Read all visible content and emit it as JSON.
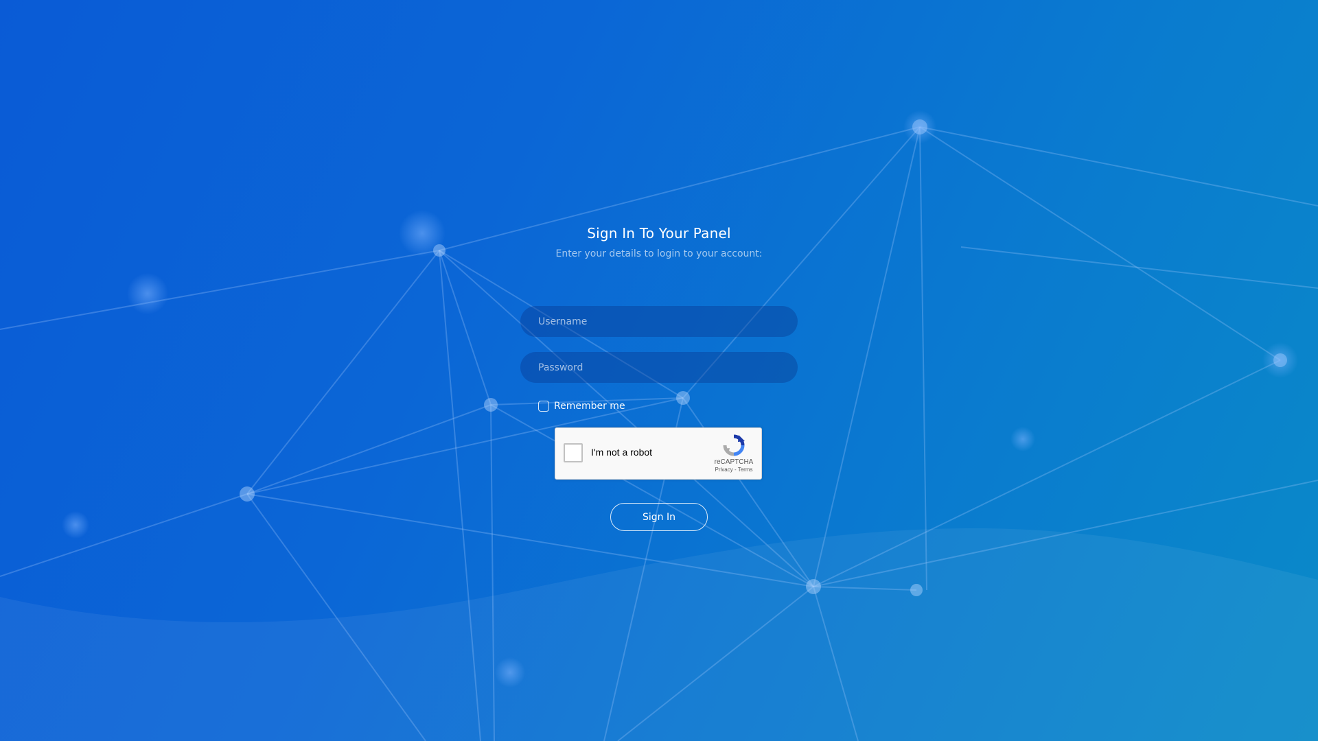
{
  "login": {
    "title": "Sign In To Your Panel",
    "subtitle": "Enter your details to login to your account:",
    "username_placeholder": "Username",
    "password_placeholder": "Password",
    "remember_label": "Remember me",
    "submit_label": "Sign In"
  },
  "captcha": {
    "label": "I'm not a robot",
    "brand": "reCAPTCHA",
    "legal": "Privacy - Terms"
  },
  "colors": {
    "background_start": "#0a5bd6",
    "background_end": "#0a8ac8",
    "input_fill": "rgba(8,52,140,0.38)",
    "text": "#ffffff"
  }
}
